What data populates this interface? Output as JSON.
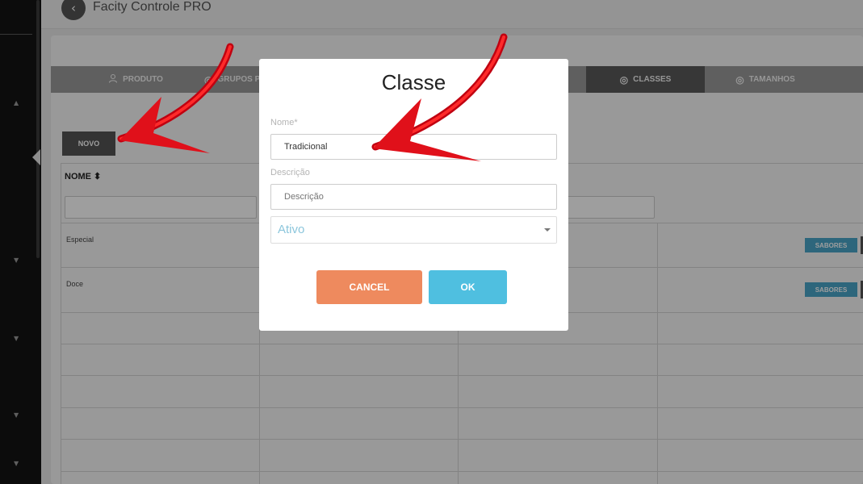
{
  "app": {
    "title": "Facity Controle PRO"
  },
  "tabs": [
    {
      "label": "PRODUTO",
      "icon": "user-icon",
      "active": false
    },
    {
      "label": "GRUPOS P",
      "icon": "fingerprint-icon",
      "active": false
    },
    {
      "label": "CLASSES",
      "icon": "fingerprint-icon",
      "active": true
    },
    {
      "label": "TAMANHOS",
      "icon": "fingerprint-icon",
      "active": false
    }
  ],
  "toolbar": {
    "novo_label": "NOVO"
  },
  "table": {
    "columns": [
      {
        "label": "NOME ⬍"
      }
    ],
    "rows": [
      {
        "nome": "Especial",
        "action": "SABORES"
      },
      {
        "nome": "Doce",
        "action": "SABORES"
      }
    ]
  },
  "modal": {
    "title": "Classe",
    "nome_label": "Nome*",
    "nome_value": "Tradicional",
    "descricao_label": "Descrição",
    "descricao_value": "Descrição",
    "ativo_placeholder": "Ativo",
    "cancel_label": "CANCEL",
    "ok_label": "OK"
  },
  "colors": {
    "cancel": "#ee8a5e",
    "ok": "#4fbfe0",
    "sabores": "#4aa5c8",
    "annotation_arrow": "#e0101a"
  }
}
